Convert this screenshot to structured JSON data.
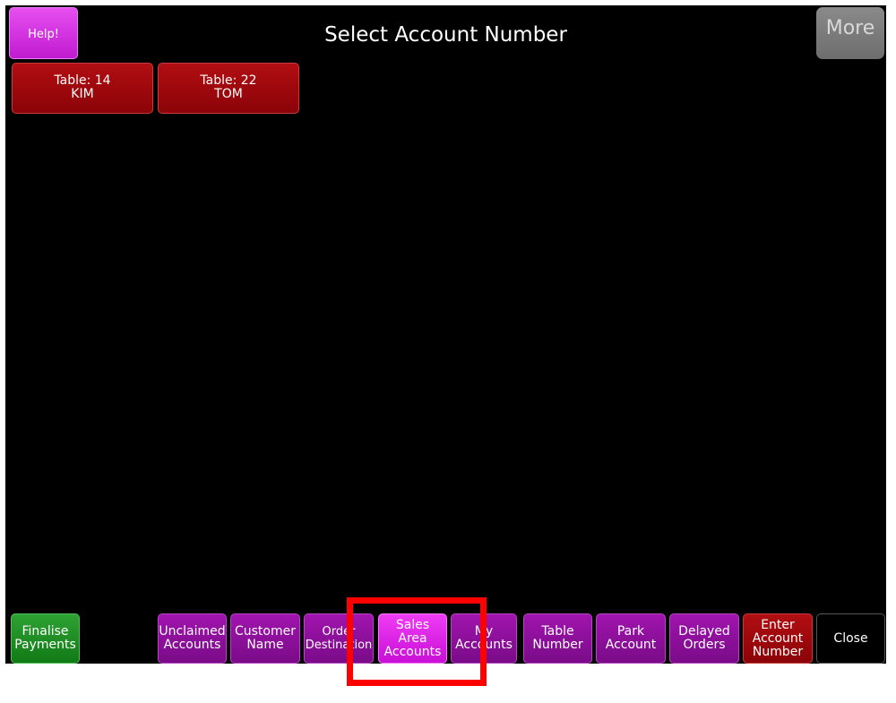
{
  "header": {
    "title": "Select Account Number",
    "help_label": "Help!",
    "more_label": "More"
  },
  "tables": [
    {
      "label": "Table: 14\nKIM"
    },
    {
      "label": "Table: 22\nTOM"
    }
  ],
  "footer": {
    "buttons": [
      {
        "label": "Finalise\nPayments"
      },
      {
        "label": "Unclaimed\nAccounts"
      },
      {
        "label": "Customer\nName"
      },
      {
        "label": "Order\nDestination"
      },
      {
        "label": "Sales\nArea\nAccounts"
      },
      {
        "label": "My\nAccounts"
      },
      {
        "label": "Table\nNumber"
      },
      {
        "label": "Park\nAccount"
      },
      {
        "label": "Delayed\nOrders"
      },
      {
        "label": "Enter\nAccount\nNumber"
      },
      {
        "label": "Close"
      }
    ]
  },
  "colors": {
    "background": "#000000",
    "purple_button": "#8a0f98",
    "magenta_button": "#d61fe3",
    "red_button": "#9e080c",
    "green_button": "#1e8e23",
    "highlight_box": "#ff0000"
  }
}
